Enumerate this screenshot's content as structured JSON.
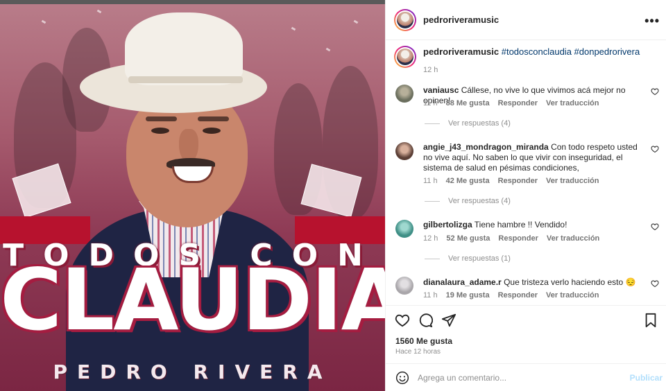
{
  "post_image": {
    "headline_top": "TODOS CON",
    "headline_main": "CLAUDIA",
    "footer_name": "PEDRO RIVERA"
  },
  "header": {
    "username": "pedroriveramusic",
    "more_icon": "more-horizontal-icon"
  },
  "caption": {
    "username": "pedroriveramusic",
    "hashtags": "#todosconclaudia #donpedrorivera",
    "time": "12 h"
  },
  "comments": [
    {
      "username": "vaniausc",
      "text": "Cállese, no vive lo que vivimos acá mejor no opinen!",
      "time": "11 h",
      "likes": "88 Me gusta",
      "reply": "Responder",
      "translate": "Ver traducción",
      "replies": "Ver respuestas (4)",
      "avatar_color": "#6b6f5e"
    },
    {
      "username": "angie_j43_mondragon_miranda",
      "text": "Con todo respeto usted no vive aquí. No saben lo que vivir con inseguridad, el sistema de salud en pésimas condiciones,",
      "time": "11 h",
      "likes": "42 Me gusta",
      "reply": "Responder",
      "translate": "Ver traducción",
      "replies": "Ver respuestas (4)",
      "avatar_color": "#5b3f36"
    },
    {
      "username": "gilbertolizga",
      "text": "Tiene hambre !! Vendido!",
      "time": "12 h",
      "likes": "52 Me gusta",
      "reply": "Responder",
      "translate": "Ver traducción",
      "replies": "Ver respuestas (1)",
      "avatar_color": "#3f8f86"
    },
    {
      "username": "dianalaura_adame.r",
      "text": "Que tristeza verlo haciendo esto 😔",
      "time": "11 h",
      "likes": "19 Me gusta",
      "reply": "Responder",
      "translate": "Ver traducción",
      "replies": "",
      "avatar_color": "#a9a6aa"
    }
  ],
  "actions": {
    "likes": "1560 Me gusta",
    "ago": "Hace 12 horas"
  },
  "comment_box": {
    "placeholder": "Agrega un comentario...",
    "publish": "Publicar"
  },
  "colors": {
    "hashtag": "#00376b",
    "publish_disabled": "#b2dffc",
    "headline_outline": "#a51c40"
  }
}
